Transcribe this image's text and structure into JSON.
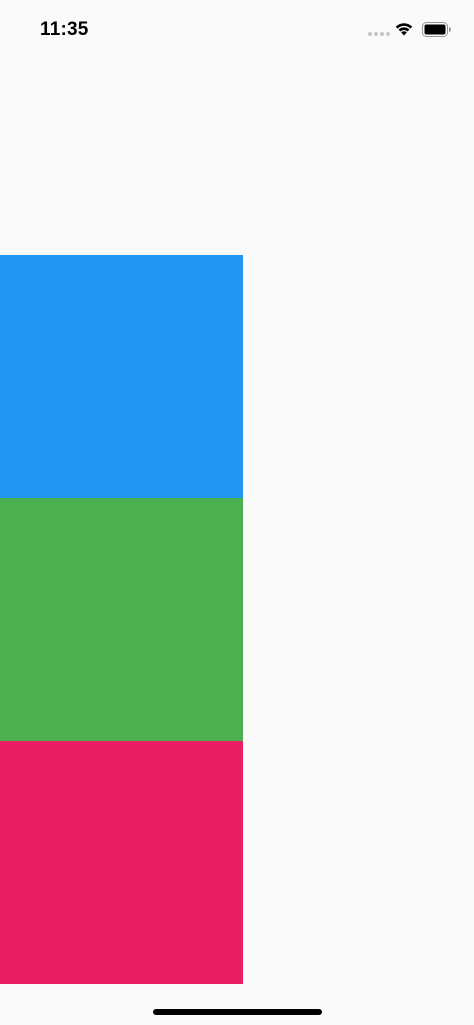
{
  "status_bar": {
    "time": "11:35",
    "icons": [
      "signal-icon",
      "wifi-icon",
      "battery-icon"
    ]
  },
  "blocks": [
    {
      "name": "blue-block",
      "color": "#2196f3"
    },
    {
      "name": "green-block",
      "color": "#4caf50"
    },
    {
      "name": "pink-block",
      "color": "#e91e63"
    }
  ],
  "colors": {
    "background": "#fafafa",
    "status_text": "#000000"
  }
}
